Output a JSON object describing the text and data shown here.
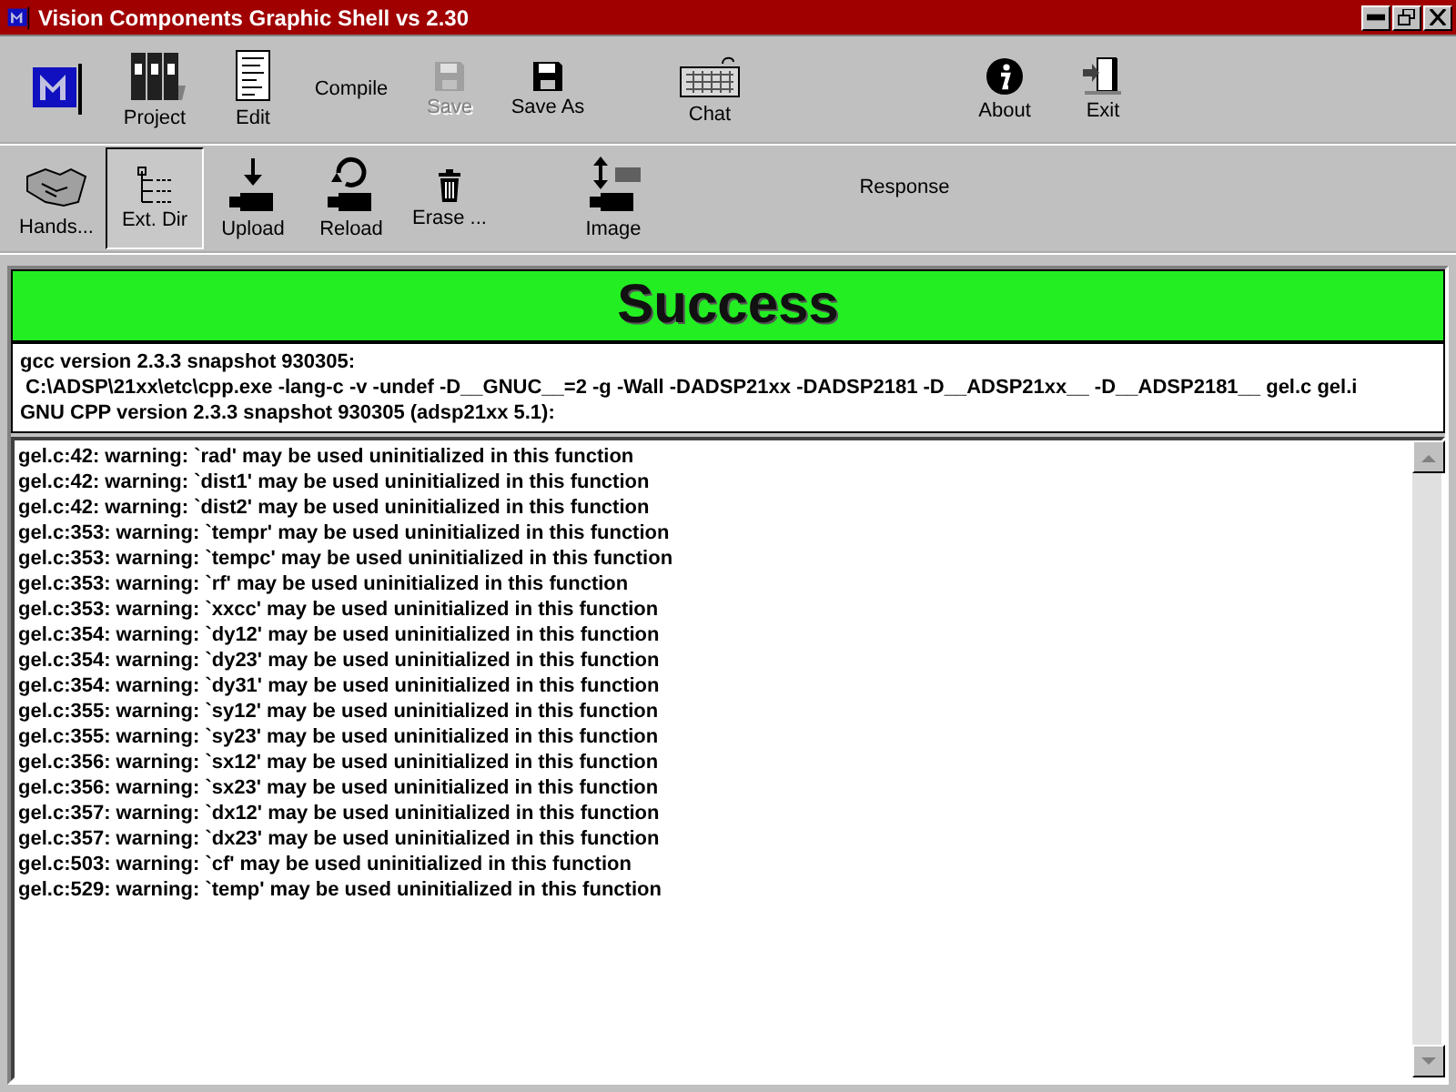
{
  "window": {
    "title": "Vision Components Graphic Shell vs 2.30"
  },
  "toolbar_1": [
    {
      "kind": "logo",
      "disabled": false,
      "selected": false
    },
    {
      "kind": "binders",
      "label": "Project",
      "disabled": false,
      "selected": false
    },
    {
      "kind": "document",
      "label": "Edit",
      "disabled": false,
      "selected": false
    },
    {
      "kind": "text",
      "label": "Compile",
      "disabled": false,
      "selected": false
    },
    {
      "kind": "disk",
      "label": "Save",
      "disabled": true,
      "selected": false
    },
    {
      "kind": "disk",
      "label": "Save As",
      "disabled": false,
      "selected": false
    },
    {
      "kind": "keyboard",
      "label": "Chat",
      "disabled": false,
      "selected": false
    },
    {
      "kind": "info",
      "label": "About",
      "disabled": false,
      "selected": false
    },
    {
      "kind": "door",
      "label": "Exit",
      "disabled": false,
      "selected": false
    }
  ],
  "toolbar_2": [
    {
      "kind": "handshake",
      "label": "Hands...",
      "disabled": false,
      "selected": false
    },
    {
      "kind": "tree",
      "label": "Ext. Dir",
      "disabled": false,
      "selected": true
    },
    {
      "kind": "upload",
      "label": "Upload",
      "disabled": false,
      "selected": false
    },
    {
      "kind": "reload",
      "label": "Reload",
      "disabled": false,
      "selected": false
    },
    {
      "kind": "trash",
      "label": "Erase ...",
      "disabled": false,
      "selected": false
    },
    {
      "kind": "image",
      "label": "Image",
      "disabled": false,
      "selected": false
    },
    {
      "kind": "text",
      "label": "Response",
      "disabled": false,
      "selected": false
    }
  ],
  "status_banner": {
    "text": "Success",
    "color": "#22ee22"
  },
  "compiler_header": [
    "gcc version 2.3.3 snapshot 930305:",
    " C:\\ADSP\\21xx\\etc\\cpp.exe -lang-c -v -undef -D__GNUC__=2 -g -Wall -DADSP21xx -DADSP2181 -D__ADSP21xx__ -D__ADSP2181__ gel.c gel.i",
    "GNU CPP version 2.3.3 snapshot 930305 (adsp21xx 5.1):"
  ],
  "log_lines": [
    "gel.c:42: warning: `rad' may be used uninitialized in this function",
    "gel.c:42: warning: `dist1' may be used uninitialized in this function",
    "gel.c:42: warning: `dist2' may be used uninitialized in this function",
    "gel.c:353: warning: `tempr' may be used uninitialized in this function",
    "gel.c:353: warning: `tempc' may be used uninitialized in this function",
    "gel.c:353: warning: `rf' may be used uninitialized in this function",
    "gel.c:353: warning: `xxcc' may be used uninitialized in this function",
    "gel.c:354: warning: `dy12' may be used uninitialized in this function",
    "gel.c:354: warning: `dy23' may be used uninitialized in this function",
    "gel.c:354: warning: `dy31' may be used uninitialized in this function",
    "gel.c:355: warning: `sy12' may be used uninitialized in this function",
    "gel.c:355: warning: `sy23' may be used uninitialized in this function",
    "gel.c:356: warning: `sx12' may be used uninitialized in this function",
    "gel.c:356: warning: `sx23' may be used uninitialized in this function",
    "gel.c:357: warning: `dx12' may be used uninitialized in this function",
    "gel.c:357: warning: `dx23' may be used uninitialized in this function",
    "gel.c:503: warning: `cf' may be used uninitialized in this function",
    "gel.c:529: warning: `temp' may be used uninitialized in this function"
  ]
}
